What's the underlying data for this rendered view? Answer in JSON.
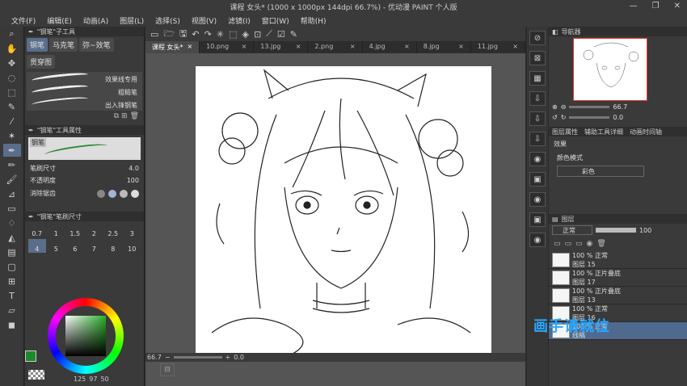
{
  "window": {
    "title": "课程 女头* (1000 x 1000px 144dpi 66.7%)  - 优动漫 PAINT 个人版",
    "minimize": "—",
    "maximize": "❐",
    "close": "✕"
  },
  "menu": [
    "文件(F)",
    "编辑(E)",
    "动画(A)",
    "图层(L)",
    "选择(S)",
    "视图(V)",
    "滤镜(I)",
    "窗口(W)",
    "帮助(H)"
  ],
  "subtool": {
    "header": "\"钢笔\"子工具",
    "tabs": [
      "钢笔",
      "马克笔",
      "弥~效笔",
      "贯穿图"
    ],
    "brushes": [
      "效果线专用",
      "粗糙笔",
      "出入锋钢笔"
    ]
  },
  "tool_property": {
    "header": "\"钢笔\"工具属性",
    "preview_label": "钢笔",
    "size_label": "笔刷尺寸",
    "size_value": "4.0",
    "opacity_label": "不透明度",
    "opacity_value": "100",
    "aa_label": "消除锯齿"
  },
  "brush_size": {
    "header": "\"钢笔\"笔刷尺寸",
    "sizes": [
      "0.7",
      "1",
      "1.5",
      "2",
      "2.5",
      "3",
      "4",
      "5",
      "6",
      "7",
      "8",
      "10"
    ]
  },
  "color": {
    "main": "#1a8a2a",
    "sub": "#1a8a2a",
    "readout": "125",
    "readout2": "97",
    "readout3": "50"
  },
  "tabs": [
    "课程 女头*",
    "10.png",
    "13.jpg",
    "2.png",
    "4.jpg",
    "8.jpg",
    "11.jpg"
  ],
  "status": {
    "zoom": "66.7",
    "angle": "0.0"
  },
  "navigator": {
    "header": "导航器",
    "zoom": "66.7",
    "angle": "0.0"
  },
  "layer_property": {
    "header": "图层属性",
    "tab2": "辅助工具详细",
    "tab3": "动画时间轴",
    "effect_label": "效果",
    "color_mode_label": "颜色模式",
    "color_mode_value": "彩色"
  },
  "layers_panel": {
    "header": "图层",
    "blend": "正常",
    "opacity": "100",
    "layers": [
      {
        "info": "100 % 正常",
        "name": "图层 15"
      },
      {
        "info": "100 % 正片叠底",
        "name": "图层 17"
      },
      {
        "info": "100 % 正片叠底",
        "name": "图层 13"
      },
      {
        "info": "100 % 正常",
        "name": "图层 16"
      },
      {
        "info": "100 % 正常",
        "name": "线稿"
      }
    ]
  },
  "watermark": "画手请就位"
}
